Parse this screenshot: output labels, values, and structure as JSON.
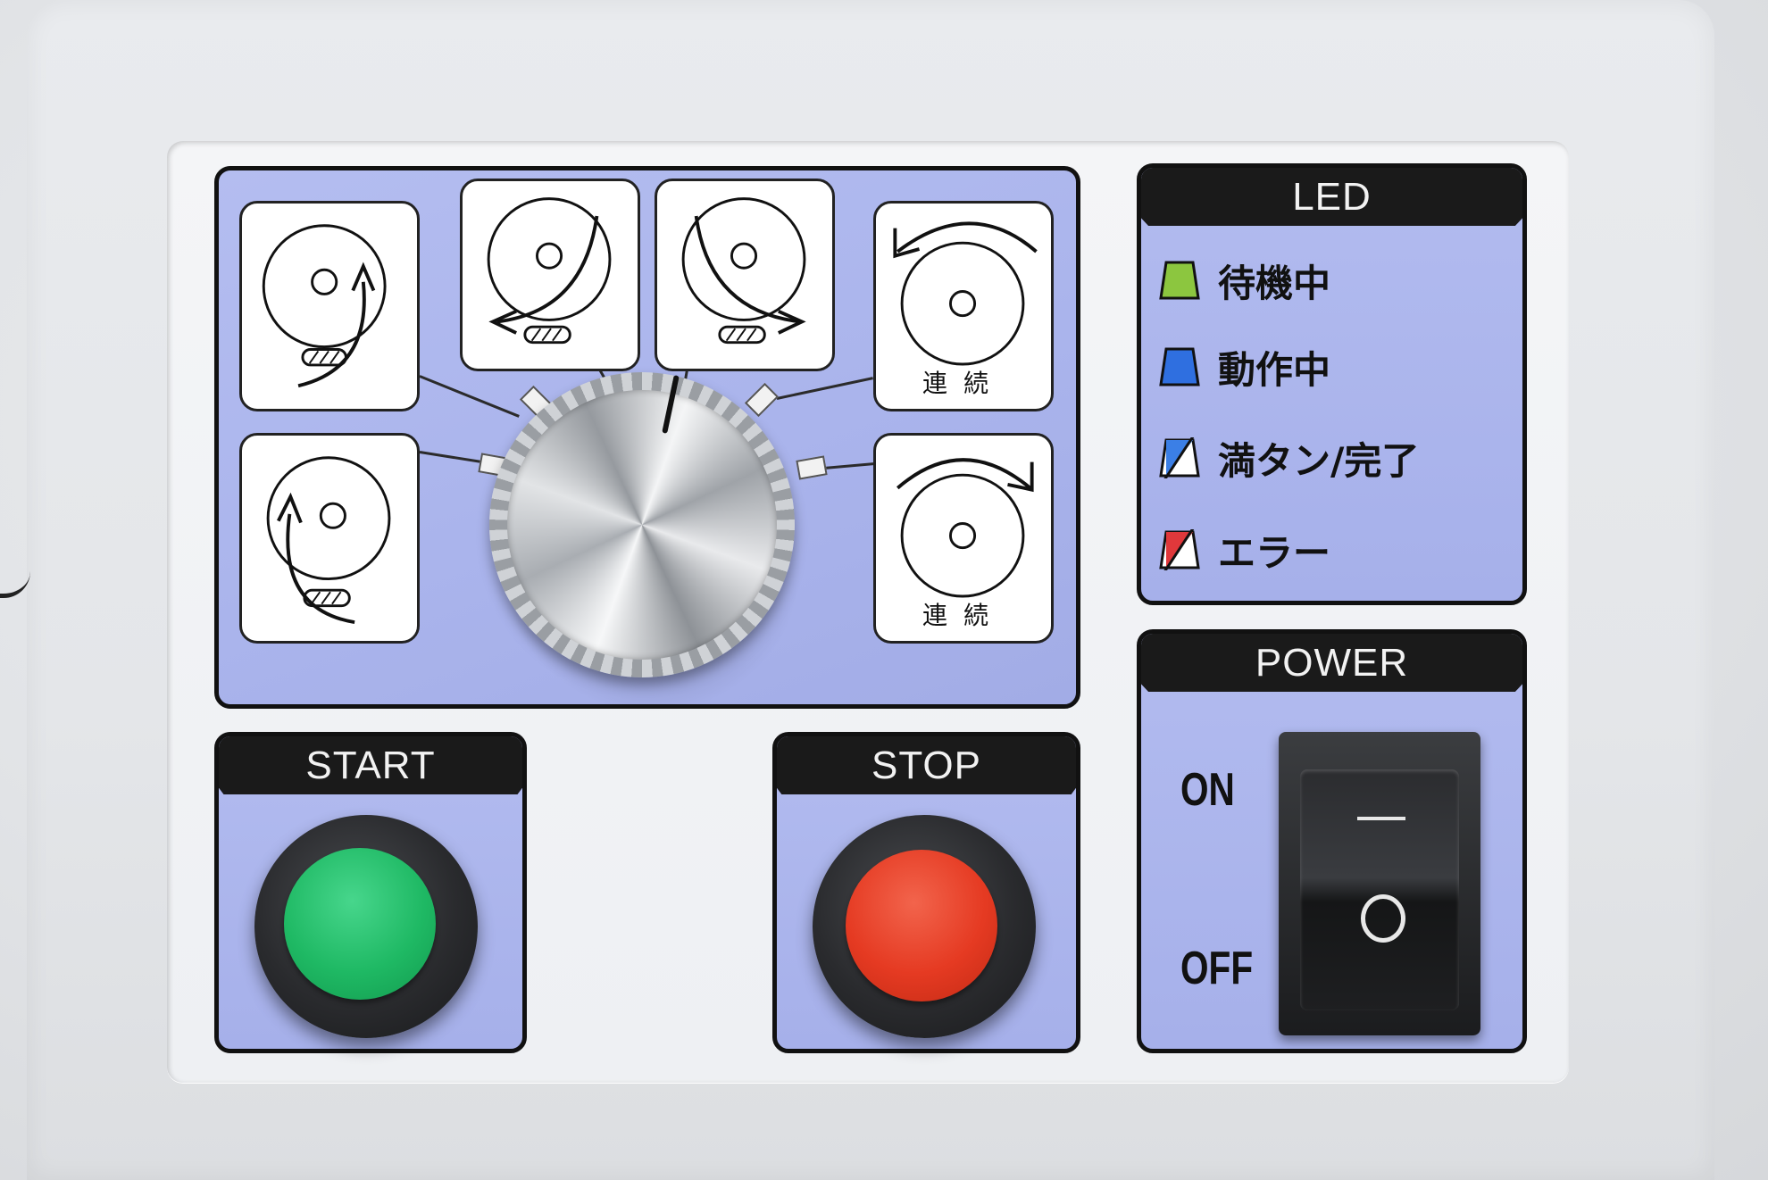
{
  "mode_selector": {
    "tiles": [
      {
        "name": "mode-tile-1",
        "label": ""
      },
      {
        "name": "mode-tile-2",
        "label": ""
      },
      {
        "name": "mode-tile-3",
        "label": ""
      },
      {
        "name": "mode-tile-4",
        "label": "連続"
      },
      {
        "name": "mode-tile-5",
        "label": ""
      },
      {
        "name": "mode-tile-6",
        "label": "連続"
      }
    ]
  },
  "led": {
    "header": "LED",
    "items": [
      {
        "label": "待機中",
        "color": "#8cc63f"
      },
      {
        "label": "動作中",
        "color": "#2f6fe0"
      },
      {
        "label": "満タン/完了",
        "color": "#3b7fe6"
      },
      {
        "label": "エラー",
        "color": "#e0383b"
      }
    ]
  },
  "power": {
    "header": "POWER",
    "on_label": "ON",
    "off_label": "OFF",
    "switch_on_mark": "—",
    "switch_off_mark": "O"
  },
  "start": {
    "header": "START",
    "button_color": "#1fb964"
  },
  "stop": {
    "header": "STOP",
    "button_color": "#e53a22"
  }
}
